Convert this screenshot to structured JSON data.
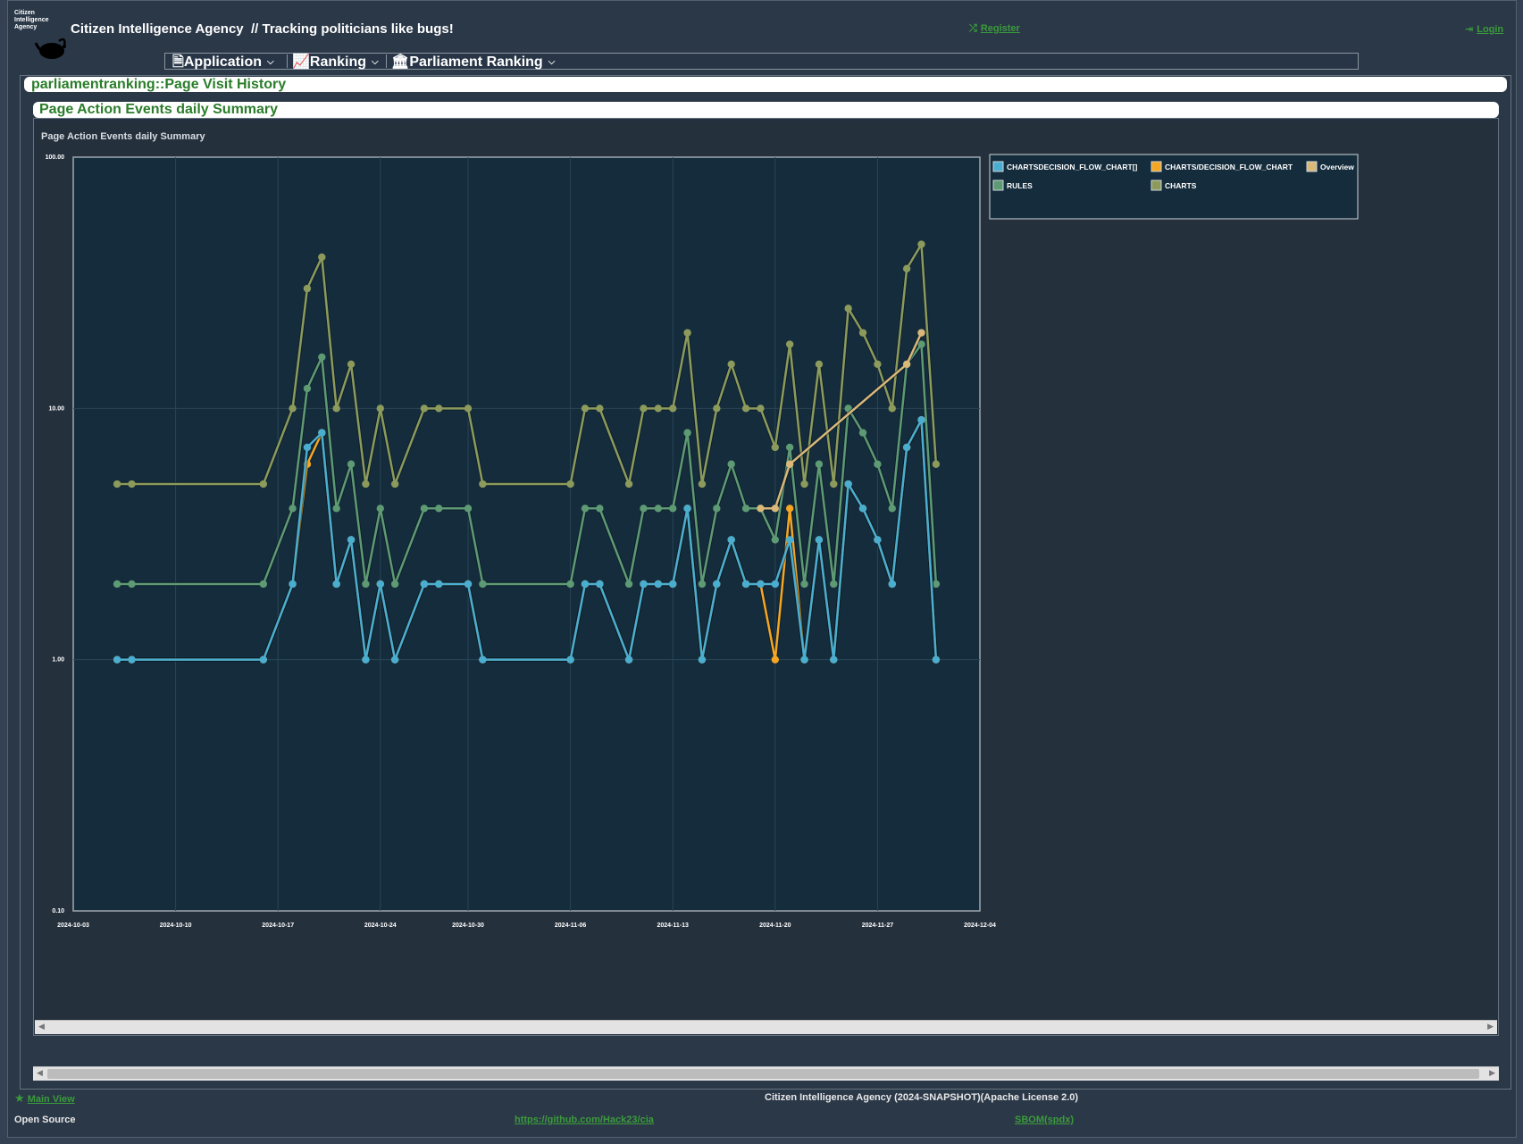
{
  "header": {
    "logo_text": [
      "Citizen",
      "Intelligence",
      "Agency"
    ],
    "title": "Citizen Intelligence Agency",
    "tagline": "// Tracking politicians like bugs!",
    "register_label": "Register",
    "login_label": "Login",
    "register_icon": "shuffle-icon",
    "login_icon": "sign-in-icon"
  },
  "menu": {
    "items": [
      {
        "label": "Application",
        "icon": "file-icon"
      },
      {
        "label": "Ranking",
        "icon": "line-chart-icon"
      },
      {
        "label": "Parliament Ranking",
        "icon": "institution-icon"
      }
    ]
  },
  "page": {
    "caption": "parliamentranking::Page Visit History",
    "panel_caption": "Page Action Events daily Summary"
  },
  "chart_data": {
    "type": "line",
    "title": "Page Action Events daily Summary",
    "yscale": "log",
    "ylim": [
      0.1,
      100
    ],
    "yticks": [
      "100.00",
      "10.00",
      "1.00",
      "0.10"
    ],
    "xlim": [
      "2024-10-03",
      "2024-12-04"
    ],
    "xticks": [
      "2024-10-03",
      "2024-10-10",
      "2024-10-17",
      "2024-10-24",
      "2024-10-30",
      "2024-11-06",
      "2024-11-13",
      "2024-11-20",
      "2024-11-27",
      "2024-12-04"
    ],
    "grid": true,
    "legend_position": "right",
    "colors": {
      "plot_background": "#142c3c",
      "frame": "#9fa8b0",
      "tick_text": "#ffffff"
    },
    "series": [
      {
        "name": "CHARTSDECISION_FLOW_CHART[]",
        "color": "#4aaed0",
        "points": [
          [
            "2024-10-06",
            1
          ],
          [
            "2024-10-07",
            1
          ],
          [
            "2024-10-16",
            1
          ],
          [
            "2024-10-18",
            2
          ],
          [
            "2024-10-19",
            7
          ],
          [
            "2024-10-20",
            8
          ],
          [
            "2024-10-21",
            2
          ],
          [
            "2024-10-22",
            3
          ],
          [
            "2024-10-23",
            1
          ],
          [
            "2024-10-24",
            2
          ],
          [
            "2024-10-25",
            1
          ],
          [
            "2024-10-27",
            2
          ],
          [
            "2024-10-28",
            2
          ],
          [
            "2024-10-30",
            2
          ],
          [
            "2024-10-31",
            1
          ],
          [
            "2024-11-06",
            1
          ],
          [
            "2024-11-07",
            2
          ],
          [
            "2024-11-08",
            2
          ],
          [
            "2024-11-10",
            1
          ],
          [
            "2024-11-11",
            2
          ],
          [
            "2024-11-12",
            2
          ],
          [
            "2024-11-13",
            2
          ],
          [
            "2024-11-14",
            4
          ],
          [
            "2024-11-15",
            1
          ],
          [
            "2024-11-16",
            2
          ],
          [
            "2024-11-17",
            3
          ],
          [
            "2024-11-18",
            2
          ],
          [
            "2024-11-19",
            2
          ],
          [
            "2024-11-20",
            2
          ],
          [
            "2024-11-21",
            3
          ],
          [
            "2024-11-22",
            1
          ],
          [
            "2024-11-23",
            3
          ],
          [
            "2024-11-24",
            1
          ],
          [
            "2024-11-25",
            5
          ],
          [
            "2024-11-26",
            4
          ],
          [
            "2024-11-27",
            3
          ],
          [
            "2024-11-28",
            2
          ],
          [
            "2024-11-29",
            7
          ],
          [
            "2024-11-30",
            9
          ],
          [
            "2024-12-01",
            1
          ]
        ]
      },
      {
        "name": "CHARTS/DECISION_FLOW_CHART",
        "color": "#f5a623",
        "points": [
          [
            "2024-10-06",
            1
          ],
          [
            "2024-10-07",
            1
          ],
          [
            "2024-10-16",
            1
          ],
          [
            "2024-10-18",
            2
          ],
          [
            "2024-10-19",
            6
          ],
          [
            "2024-10-20",
            8
          ],
          [
            "2024-10-21",
            2
          ],
          [
            "2024-10-22",
            3
          ],
          [
            "2024-10-23",
            1
          ],
          [
            "2024-10-24",
            2
          ],
          [
            "2024-10-25",
            1
          ],
          [
            "2024-10-27",
            2
          ],
          [
            "2024-10-28",
            2
          ],
          [
            "2024-10-30",
            2
          ],
          [
            "2024-10-31",
            1
          ],
          [
            "2024-11-06",
            1
          ],
          [
            "2024-11-07",
            2
          ],
          [
            "2024-11-08",
            2
          ],
          [
            "2024-11-10",
            1
          ],
          [
            "2024-11-11",
            2
          ],
          [
            "2024-11-12",
            2
          ],
          [
            "2024-11-13",
            2
          ],
          [
            "2024-11-14",
            4
          ],
          [
            "2024-11-15",
            1
          ],
          [
            "2024-11-16",
            2
          ],
          [
            "2024-11-17",
            3
          ],
          [
            "2024-11-18",
            2
          ],
          [
            "2024-11-19",
            2
          ],
          [
            "2024-11-20",
            1
          ],
          [
            "2024-11-21",
            4
          ],
          [
            "2024-11-22",
            1
          ],
          [
            "2024-11-23",
            3
          ],
          [
            "2024-11-24",
            1
          ],
          [
            "2024-11-25",
            5
          ],
          [
            "2024-11-26",
            4
          ],
          [
            "2024-11-27",
            3
          ],
          [
            "2024-11-28",
            2
          ],
          [
            "2024-11-29",
            7
          ],
          [
            "2024-11-30",
            9
          ],
          [
            "2024-12-01",
            1
          ]
        ]
      },
      {
        "name": "Overview",
        "color": "#d9b87a",
        "points": [
          [
            "2024-11-19",
            4
          ],
          [
            "2024-11-20",
            4
          ],
          [
            "2024-11-21",
            6
          ],
          [
            "2024-11-29",
            15
          ],
          [
            "2024-11-30",
            20
          ]
        ]
      },
      {
        "name": "RULES",
        "color": "#5e9a73",
        "points": [
          [
            "2024-10-06",
            2
          ],
          [
            "2024-10-07",
            2
          ],
          [
            "2024-10-16",
            2
          ],
          [
            "2024-10-18",
            4
          ],
          [
            "2024-10-19",
            12
          ],
          [
            "2024-10-20",
            16
          ],
          [
            "2024-10-21",
            4
          ],
          [
            "2024-10-22",
            6
          ],
          [
            "2024-10-23",
            2
          ],
          [
            "2024-10-24",
            4
          ],
          [
            "2024-10-25",
            2
          ],
          [
            "2024-10-27",
            4
          ],
          [
            "2024-10-28",
            4
          ],
          [
            "2024-10-30",
            4
          ],
          [
            "2024-10-31",
            2
          ],
          [
            "2024-11-06",
            2
          ],
          [
            "2024-11-07",
            4
          ],
          [
            "2024-11-08",
            4
          ],
          [
            "2024-11-10",
            2
          ],
          [
            "2024-11-11",
            4
          ],
          [
            "2024-11-12",
            4
          ],
          [
            "2024-11-13",
            4
          ],
          [
            "2024-11-14",
            8
          ],
          [
            "2024-11-15",
            2
          ],
          [
            "2024-11-16",
            4
          ],
          [
            "2024-11-17",
            6
          ],
          [
            "2024-11-18",
            4
          ],
          [
            "2024-11-19",
            4
          ],
          [
            "2024-11-20",
            3
          ],
          [
            "2024-11-21",
            7
          ],
          [
            "2024-11-22",
            2
          ],
          [
            "2024-11-23",
            6
          ],
          [
            "2024-11-24",
            2
          ],
          [
            "2024-11-25",
            10
          ],
          [
            "2024-11-26",
            8
          ],
          [
            "2024-11-27",
            6
          ],
          [
            "2024-11-28",
            4
          ],
          [
            "2024-11-29",
            15
          ],
          [
            "2024-11-30",
            18
          ],
          [
            "2024-12-01",
            2
          ]
        ]
      },
      {
        "name": "CHARTS",
        "color": "#8c9a5b",
        "points": [
          [
            "2024-10-06",
            5
          ],
          [
            "2024-10-07",
            5
          ],
          [
            "2024-10-16",
            5
          ],
          [
            "2024-10-18",
            10
          ],
          [
            "2024-10-19",
            30
          ],
          [
            "2024-10-20",
            40
          ],
          [
            "2024-10-21",
            10
          ],
          [
            "2024-10-22",
            15
          ],
          [
            "2024-10-23",
            5
          ],
          [
            "2024-10-24",
            10
          ],
          [
            "2024-10-25",
            5
          ],
          [
            "2024-10-27",
            10
          ],
          [
            "2024-10-28",
            10
          ],
          [
            "2024-10-30",
            10
          ],
          [
            "2024-10-31",
            5
          ],
          [
            "2024-11-06",
            5
          ],
          [
            "2024-11-07",
            10
          ],
          [
            "2024-11-08",
            10
          ],
          [
            "2024-11-10",
            5
          ],
          [
            "2024-11-11",
            10
          ],
          [
            "2024-11-12",
            10
          ],
          [
            "2024-11-13",
            10
          ],
          [
            "2024-11-14",
            20
          ],
          [
            "2024-11-15",
            5
          ],
          [
            "2024-11-16",
            10
          ],
          [
            "2024-11-17",
            15
          ],
          [
            "2024-11-18",
            10
          ],
          [
            "2024-11-19",
            10
          ],
          [
            "2024-11-20",
            7
          ],
          [
            "2024-11-21",
            18
          ],
          [
            "2024-11-22",
            5
          ],
          [
            "2024-11-23",
            15
          ],
          [
            "2024-11-24",
            5
          ],
          [
            "2024-11-25",
            25
          ],
          [
            "2024-11-26",
            20
          ],
          [
            "2024-11-27",
            15
          ],
          [
            "2024-11-28",
            10
          ],
          [
            "2024-11-29",
            36
          ],
          [
            "2024-11-30",
            45
          ],
          [
            "2024-12-01",
            6
          ]
        ]
      }
    ]
  },
  "footer": {
    "main_view_label": "Main View",
    "main_view_icon": "star-icon",
    "version_text": "Citizen Intelligence Agency (2024-SNAPSHOT)(Apache License 2.0)",
    "open_source_label": "Open Source",
    "github_link": "https://github.com/Hack23/cia",
    "sbom_link": "SBOM(spdx)"
  }
}
